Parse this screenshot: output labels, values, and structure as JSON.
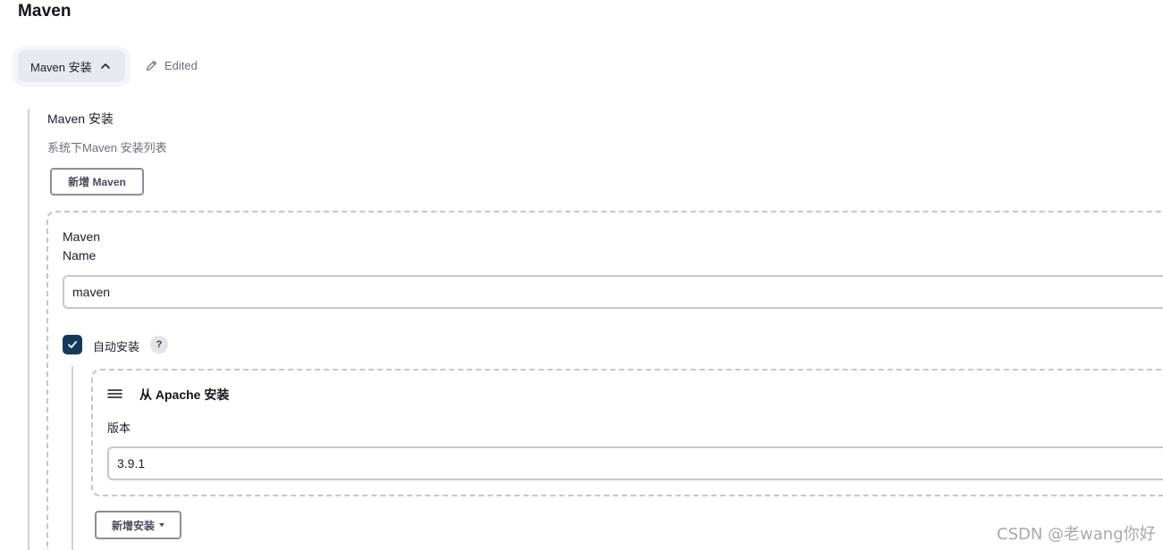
{
  "section": {
    "title": "Maven"
  },
  "toggle": {
    "label": "Maven 安装",
    "state_icon": "chevron-up-icon",
    "edited_label": "Edited"
  },
  "installations": {
    "label": "Maven 安装",
    "description": "系统下Maven 安装列表",
    "add_button": "新增 Maven"
  },
  "maven_entry": {
    "name_label_line1": "Maven",
    "name_label_line2": "Name",
    "name_value": "maven",
    "auto_install": {
      "label": "自动安装",
      "checked": true,
      "help": "?"
    },
    "installer": {
      "title": "从 Apache 安装",
      "version_label": "版本",
      "version_value": "3.9.1"
    },
    "add_installer_button": "新增安装"
  },
  "watermark": "CSDN @老wang你好",
  "colors": {
    "checkbox": "#153a5c",
    "toggle_bg": "#e8e8f1",
    "muted_text": "#6d6d80"
  }
}
